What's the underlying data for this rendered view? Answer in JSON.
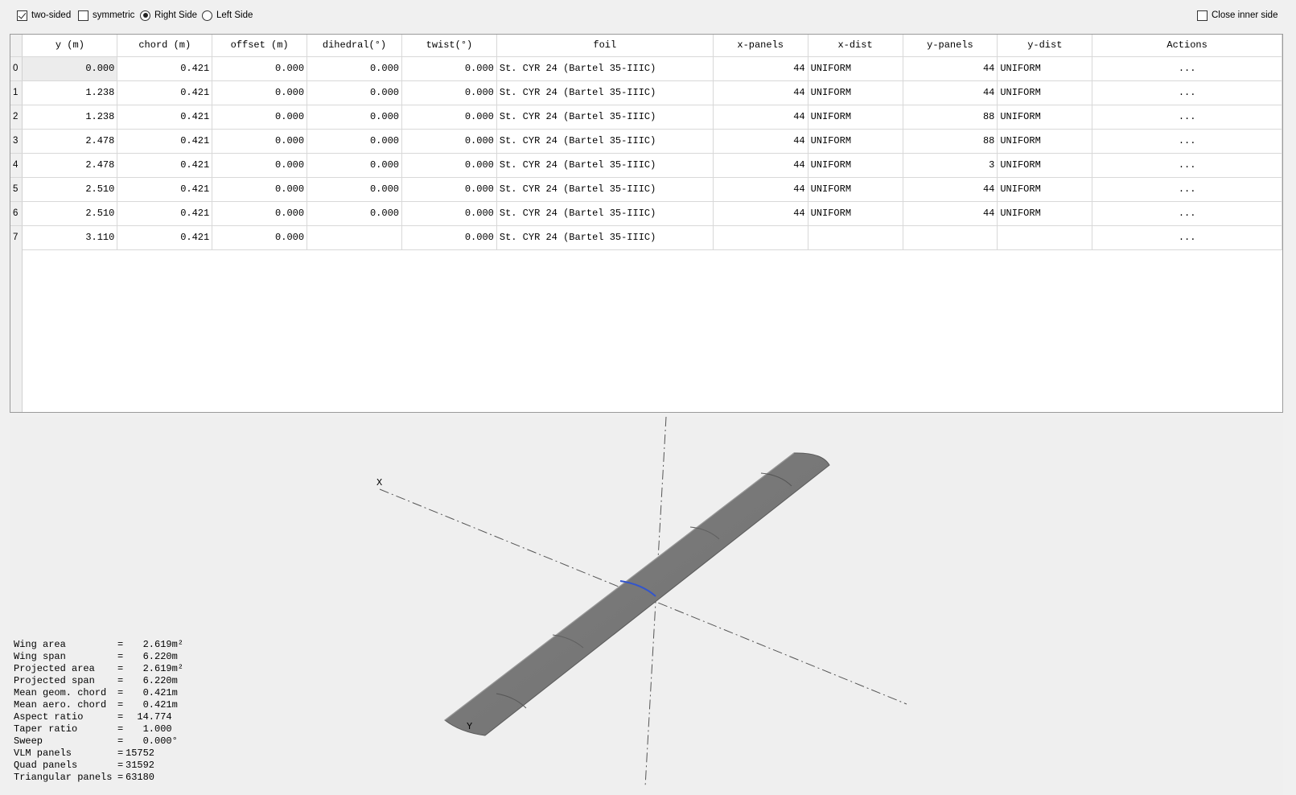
{
  "options": {
    "two_sided": {
      "label": "two-sided",
      "checked": true
    },
    "symmetric": {
      "label": "symmetric",
      "checked": false
    },
    "right_side": {
      "label": "Right Side",
      "selected": true
    },
    "left_side": {
      "label": "Left Side",
      "selected": false
    },
    "close_inner_side": {
      "label": "Close inner side",
      "checked": false
    }
  },
  "table": {
    "columns": [
      "y (m)",
      "chord (m)",
      "offset (m)",
      "dihedral(°)",
      "twist(°)",
      "foil",
      "x-panels",
      "x-dist",
      "y-panels",
      "y-dist",
      "Actions"
    ],
    "rows": [
      {
        "idx": "0",
        "y": "0.000",
        "chord": "0.421",
        "offset": "0.000",
        "dihedral": "0.000",
        "twist": "0.000",
        "foil": "St. CYR 24 (Bartel 35-IIIC)",
        "xpanels": "44",
        "xdist": "UNIFORM",
        "ypanels": "44",
        "ydist": "UNIFORM",
        "actions": "..."
      },
      {
        "idx": "1",
        "y": "1.238",
        "chord": "0.421",
        "offset": "0.000",
        "dihedral": "0.000",
        "twist": "0.000",
        "foil": "St. CYR 24 (Bartel 35-IIIC)",
        "xpanels": "44",
        "xdist": "UNIFORM",
        "ypanels": "44",
        "ydist": "UNIFORM",
        "actions": "..."
      },
      {
        "idx": "2",
        "y": "1.238",
        "chord": "0.421",
        "offset": "0.000",
        "dihedral": "0.000",
        "twist": "0.000",
        "foil": "St. CYR 24 (Bartel 35-IIIC)",
        "xpanels": "44",
        "xdist": "UNIFORM",
        "ypanels": "88",
        "ydist": "UNIFORM",
        "actions": "..."
      },
      {
        "idx": "3",
        "y": "2.478",
        "chord": "0.421",
        "offset": "0.000",
        "dihedral": "0.000",
        "twist": "0.000",
        "foil": "St. CYR 24 (Bartel 35-IIIC)",
        "xpanels": "44",
        "xdist": "UNIFORM",
        "ypanels": "88",
        "ydist": "UNIFORM",
        "actions": "..."
      },
      {
        "idx": "4",
        "y": "2.478",
        "chord": "0.421",
        "offset": "0.000",
        "dihedral": "0.000",
        "twist": "0.000",
        "foil": "St. CYR 24 (Bartel 35-IIIC)",
        "xpanels": "44",
        "xdist": "UNIFORM",
        "ypanels": "3",
        "ydist": "UNIFORM",
        "actions": "..."
      },
      {
        "idx": "5",
        "y": "2.510",
        "chord": "0.421",
        "offset": "0.000",
        "dihedral": "0.000",
        "twist": "0.000",
        "foil": "St. CYR 24 (Bartel 35-IIIC)",
        "xpanels": "44",
        "xdist": "UNIFORM",
        "ypanels": "44",
        "ydist": "UNIFORM",
        "actions": "..."
      },
      {
        "idx": "6",
        "y": "2.510",
        "chord": "0.421",
        "offset": "0.000",
        "dihedral": "0.000",
        "twist": "0.000",
        "foil": "St. CYR 24 (Bartel 35-IIIC)",
        "xpanels": "44",
        "xdist": "UNIFORM",
        "ypanels": "44",
        "ydist": "UNIFORM",
        "actions": "..."
      },
      {
        "idx": "7",
        "y": "3.110",
        "chord": "0.421",
        "offset": "0.000",
        "dihedral": "",
        "twist": "0.000",
        "foil": "St. CYR 24 (Bartel 35-IIIC)",
        "xpanels": "",
        "xdist": "",
        "ypanels": "",
        "ydist": "",
        "actions": "..."
      }
    ]
  },
  "view3d": {
    "axis_x_label": "X",
    "axis_y_label": "Y",
    "wing_color": "#7a7a7a",
    "root_highlight_color": "#3355cc"
  },
  "properties": [
    {
      "label": "Wing area",
      "value": "   2.619m²"
    },
    {
      "label": "Wing span",
      "value": "   6.220m"
    },
    {
      "label": "Projected area",
      "value": "   2.619m²"
    },
    {
      "label": "Projected span",
      "value": "   6.220m"
    },
    {
      "label": "Mean geom. chord",
      "value": "   0.421m"
    },
    {
      "label": "Mean aero. chord",
      "value": "   0.421m"
    },
    {
      "label": "Aspect ratio",
      "value": "  14.774"
    },
    {
      "label": "Taper ratio",
      "value": "   1.000"
    },
    {
      "label": "Sweep",
      "value": "   0.000°"
    },
    {
      "label": "VLM panels",
      "value": "15752"
    },
    {
      "label": "Quad panels",
      "value": "31592"
    },
    {
      "label": "Triangular panels",
      "value": "63180"
    }
  ]
}
